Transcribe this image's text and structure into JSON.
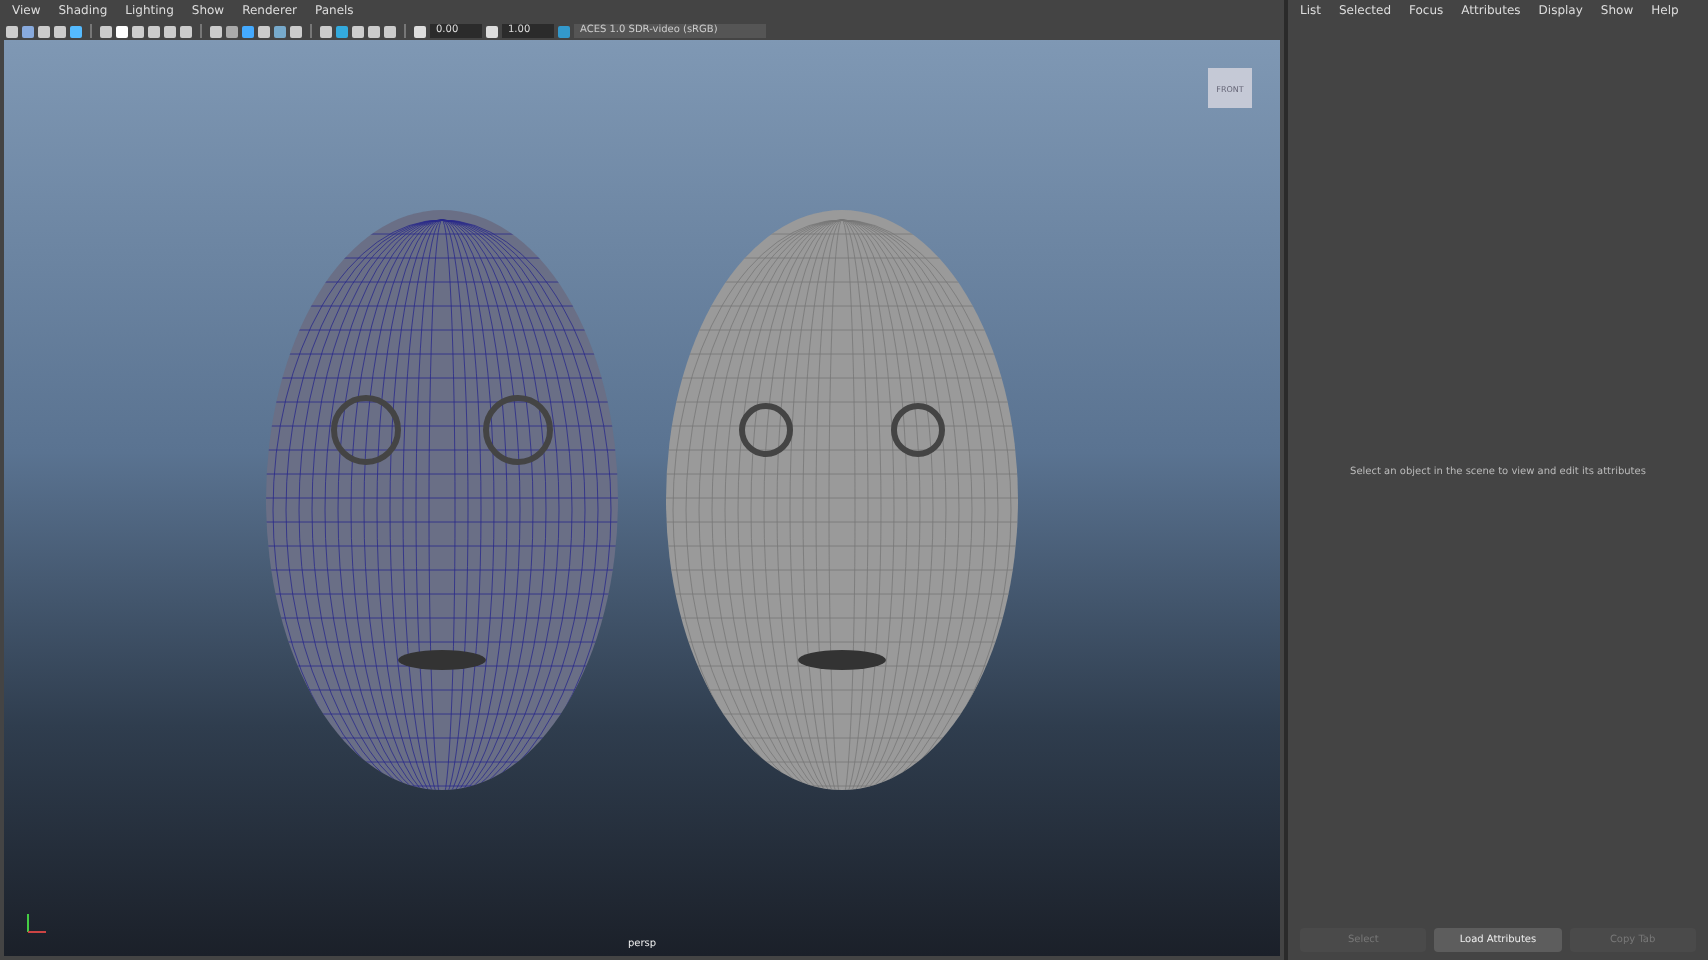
{
  "viewport": {
    "menu": [
      "View",
      "Shading",
      "Lighting",
      "Show",
      "Renderer",
      "Panels"
    ],
    "toolbar": {
      "exposure": "0.00",
      "gamma": "1.00",
      "color_space": "ACES 1.0 SDR-video (sRGB)"
    },
    "view_cube": "FRONT",
    "camera": "persp"
  },
  "attribute_editor": {
    "menu": [
      "List",
      "Selected",
      "Focus",
      "Attributes",
      "Display",
      "Show",
      "Help"
    ],
    "message": "Select an object in the scene to view and edit its attributes",
    "buttons": [
      {
        "label": "Select",
        "disabled": true
      },
      {
        "label": "Load Attributes",
        "disabled": false
      },
      {
        "label": "Copy Tab",
        "disabled": true
      }
    ]
  }
}
